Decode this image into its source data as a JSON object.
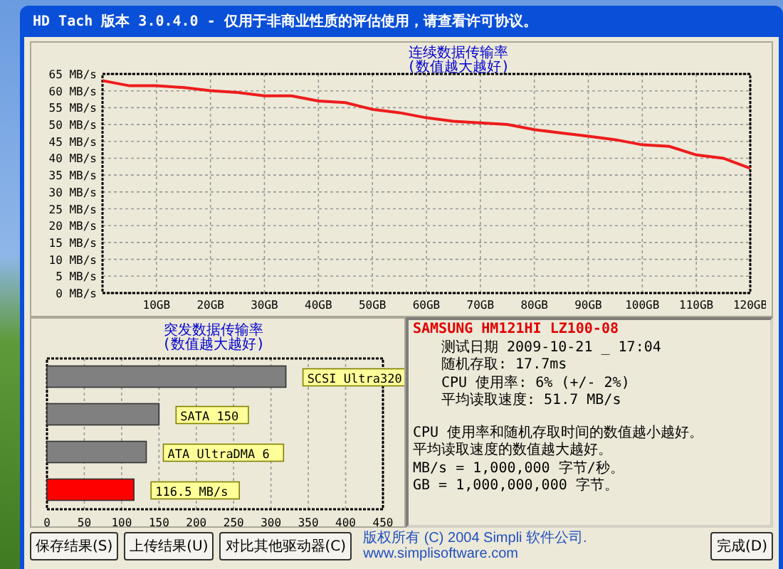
{
  "window": {
    "title": "HD Tach 版本 3.0.4.0  - 仅用于非商业性质的评估使用，请查看许可协议。"
  },
  "sequential_panel": {
    "title_note": "(数值越大越好)",
    "chart_data": {
      "type": "line",
      "title": "连续数据传输率",
      "x": [
        0,
        5,
        10,
        15,
        20,
        25,
        30,
        35,
        40,
        45,
        50,
        55,
        60,
        65,
        70,
        75,
        80,
        85,
        90,
        95,
        100,
        105,
        110,
        115,
        120
      ],
      "series": [
        {
          "color": "#ee1c1c",
          "values": [
            63,
            61.5,
            61.5,
            61,
            60,
            59.5,
            58.5,
            58.5,
            57,
            56.5,
            54.5,
            53.5,
            52,
            51,
            50.5,
            50,
            48.5,
            47.5,
            46.5,
            45.5,
            44,
            43.5,
            41,
            40,
            37
          ]
        }
      ],
      "xlim": [
        0,
        120
      ],
      "ylim": [
        0,
        65
      ],
      "grid": true,
      "xticks": [
        {
          "value": 10,
          "label": "10GB"
        },
        {
          "value": 20,
          "label": "20GB"
        },
        {
          "value": 30,
          "label": "30GB"
        },
        {
          "value": 40,
          "label": "40GB"
        },
        {
          "value": 50,
          "label": "50GB"
        },
        {
          "value": 60,
          "label": "60GB"
        },
        {
          "value": 70,
          "label": "70GB"
        },
        {
          "value": 80,
          "label": "80GB"
        },
        {
          "value": 90,
          "label": "90GB"
        },
        {
          "value": 100,
          "label": "100GB"
        },
        {
          "value": 110,
          "label": "110GB"
        },
        {
          "value": 120,
          "label": "120GB"
        }
      ],
      "yticks": [
        {
          "value": 0,
          "label": "0 MB/s"
        },
        {
          "value": 5,
          "label": "5 MB/s"
        },
        {
          "value": 10,
          "label": "10 MB/s"
        },
        {
          "value": 15,
          "label": "15 MB/s"
        },
        {
          "value": 20,
          "label": "20 MB/s"
        },
        {
          "value": 25,
          "label": "25 MB/s"
        },
        {
          "value": 30,
          "label": "30 MB/s"
        },
        {
          "value": 35,
          "label": "35 MB/s"
        },
        {
          "value": 40,
          "label": "40 MB/s"
        },
        {
          "value": 45,
          "label": "45 MB/s"
        },
        {
          "value": 50,
          "label": "50 MB/s"
        },
        {
          "value": 55,
          "label": "55 MB/s"
        },
        {
          "value": 60,
          "label": "60 MB/s"
        },
        {
          "value": 65,
          "label": "65 MB/s"
        }
      ]
    }
  },
  "burst_panel": {
    "title_note": "(数值越大越好)",
    "chart_data": {
      "type": "bar",
      "orientation": "horizontal",
      "title": "突发数据传输率",
      "categories": [
        "SCSI Ultra320",
        "SATA 150",
        "ATA UltraDMA 6",
        "116.5 MB/s"
      ],
      "series": [
        {
          "color": "#808080",
          "values": [
            320,
            150,
            133,
            null
          ]
        },
        {
          "color": "#ff0000",
          "values": [
            null,
            null,
            null,
            116.5
          ]
        }
      ],
      "xlim": [
        0,
        450
      ],
      "grid": true,
      "xticks": [
        0,
        50,
        100,
        150,
        200,
        250,
        300,
        350,
        400,
        450
      ]
    }
  },
  "info_panel": {
    "drive": "SAMSUNG HM121HI LZ100-08",
    "results": [
      "测试日期 2009-10-21 _ 17:04",
      "随机存取: 17.7ms",
      "CPU 使用率: 6% (+/- 2%)",
      "平均读取速度: 51.7 MB/s"
    ],
    "notes": [
      "CPU 使用率和随机存取时间的数值越小越好。",
      "平均读取速度的数值越大越好。",
      "MB/s = 1,000,000 字节/秒。",
      "GB = 1,000,000,000 字节。"
    ]
  },
  "buttons": [
    "保存结果(S)",
    "上传结果(U)",
    "对比其他驱动器(C)"
  ],
  "footer": "版权所有 (C) 2004 Simpli 软件公司. www.simplisoftware.com",
  "done_button": "完成(D)"
}
